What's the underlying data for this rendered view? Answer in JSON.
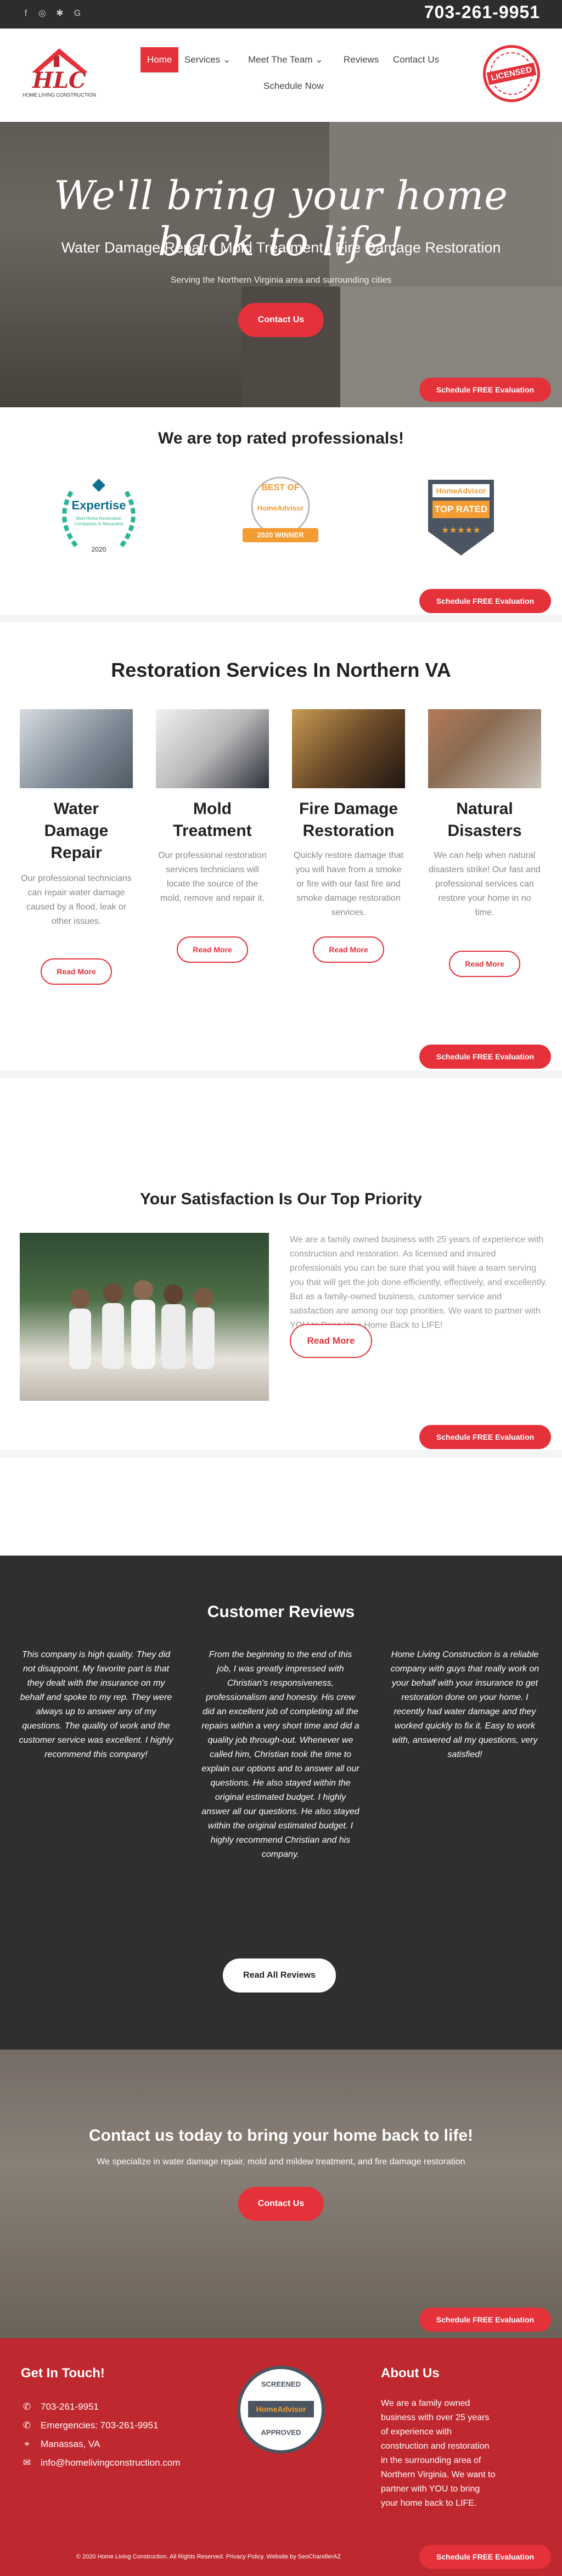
{
  "topbar": {
    "phone": "703-261-9951",
    "social": [
      "facebook-icon",
      "instagram-icon",
      "yelp-icon",
      "google-icon"
    ]
  },
  "logo": {
    "mark": "HLC",
    "tagline": "HOME LIVING CONSTRUCTION"
  },
  "nav": {
    "items": [
      "Home",
      "Services",
      "Meet The Team",
      "Reviews",
      "Contact Us",
      "Schedule Now"
    ],
    "active": "Home"
  },
  "seal": {
    "text": "LICENSED"
  },
  "hero": {
    "script": "We'll bring your home back to life!",
    "subtitle": "Water Damage Repair | Mold Treatment | Fire Damage Restoration",
    "small": "Serving the Northern Virginia area and surrounding cities",
    "cta": "Contact Us"
  },
  "schedule_label": "Schedule FREE Evaluation",
  "top_rated": {
    "heading": "We are top rated professionals!",
    "badges": {
      "expertise": {
        "title": "Expertise",
        "sub": "Best Home Restoration Companies in Alexandria",
        "year": "2020"
      },
      "best_of": {
        "top": "BEST OF",
        "brand": "HomeAdvisor",
        "bottom": "2020 WINNER"
      },
      "top_rated": {
        "brand": "HomeAdvisor",
        "label": "TOP RATED"
      }
    }
  },
  "services": {
    "heading": "Restoration Services In Northern VA",
    "items": [
      {
        "title": "Water Damage Repair",
        "desc": "Our professional technicians can repair water damage caused by a flood, leak or other issues.",
        "button": "Read More"
      },
      {
        "title": "Mold Treatment",
        "desc": "Our professional restoration services technicians will locate the source of the mold, remove and repair it.",
        "button": "Read More"
      },
      {
        "title": "Fire Damage Restoration",
        "desc": "Quickly restore damage that you will have from a smoke or fire with our fast fire and smoke damage restoration services.",
        "button": "Read More"
      },
      {
        "title": "Natural Disasters",
        "desc": "We can help when natural disasters strike! Our fast and professional services can restore your home in no time.",
        "button": "Read More"
      }
    ]
  },
  "about": {
    "heading": "Your Satisfaction Is Our Top Priority",
    "text": "We are a family owned business with 25 years of experience with construction and restoration. As licensed and insured professionals you can be sure that you will have a team serving you that will get the job done efficiently, effectively, and excellently. But as a family-owned business, customer service and satisfaction are among our top priorities. We want to partner with YOU to Bring Your Home Back to LIFE!",
    "button": "Read More"
  },
  "reviews": {
    "heading": "Customer Reviews",
    "items": [
      "This company is high quality. They did not disappoint. My favorite part is that they dealt with the insurance on my behalf and spoke to my rep. They were always up to answer any of my questions. The quality of work and the customer service was excellent. I highly recommend this company!",
      "From the beginning to the end of this job, I was greatly impressed with Christian's responsiveness, professionalism and honesty. His crew did an excellent job of completing all the repairs within a very short time and did a quality job through-out. Whenever we called him, Christian took the time to explain our options and to answer all our questions. He also stayed within the original estimated budget. I highly answer all our questions. He also stayed within the original estimated budget. I highly recommend Christian and his company.",
      "Home Living Construction is a reliable company with guys that really work on your behalf with your insurance to get restoration done on your home. I recently had water damage and they worked quickly to fix it. Easy to work with, answered all my questions, very satisfied!"
    ],
    "button": "Read All Reviews"
  },
  "contact_band": {
    "heading": "Contact us today to bring your home back to life!",
    "sub": "We specialize in water damage repair, mold and mildew treatment, and fire damage restoration",
    "button": "Contact Us"
  },
  "footer": {
    "touch_heading": "Get In Touch!",
    "lines": [
      "703-261-9951",
      "Emergencies: 703-261-9951",
      "Manassas, VA",
      "info@homelivingconstruction.com"
    ],
    "center_badge": {
      "top": "SCREENED",
      "brand": "HomeAdvisor",
      "bottom": "APPROVED"
    },
    "about_heading": "About Us",
    "about_text": "We are a family owned business with over 25 years of experience with construction and restoration in the surrounding area of Northern Virginia. We want to partner with YOU to bring your home back to LIFE.",
    "copyright": "© 2020 Home Living Construction. All Rights Reserved. Privacy Policy. Website by SeoChandlerAZ"
  }
}
